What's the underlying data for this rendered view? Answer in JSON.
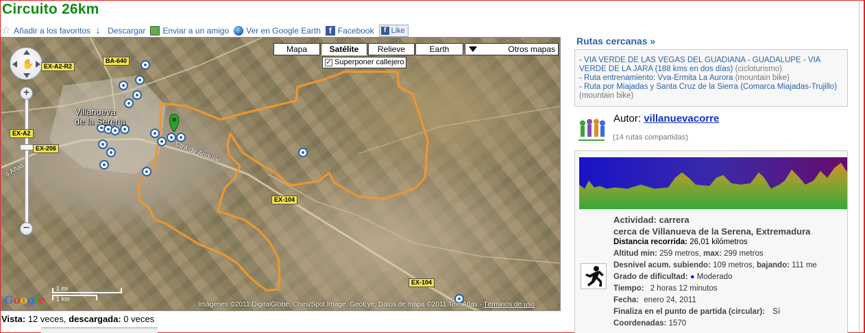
{
  "page": {
    "title": "Circuito 26km"
  },
  "actions": [
    {
      "label": "Añadir a los favoritos",
      "icon": "star-icon"
    },
    {
      "label": "Descargar",
      "icon": "download-arrow-icon"
    },
    {
      "label": "Enviar a un amigo",
      "icon": "email-icon"
    },
    {
      "label": "Ver en Google Earth",
      "icon": "google-earth-icon"
    },
    {
      "label": "Facebook",
      "icon": "facebook-icon"
    }
  ],
  "like_button": {
    "label": "Like"
  },
  "map": {
    "types": [
      "Mapa",
      "Satélite",
      "Relieve",
      "Earth"
    ],
    "active_type": "Satélite",
    "more_types": "Otros mapas",
    "overlay_checkbox": {
      "label": "Superponer callejero",
      "checked": true
    },
    "town_label": "Villanueva\nde la Serena",
    "town_line1": "Villanueva",
    "town_line2": "de la Serena",
    "road_label": "Ctra de Andújar",
    "side_road_label": "s Altas",
    "road_shields": [
      "EX-A2-R2",
      "BA-640",
      "EX-A2",
      "EX-206",
      "EX-104",
      "EX-104"
    ],
    "google_logo": "Google",
    "scale": {
      "top": "1 mi",
      "bottom": "1 km"
    },
    "attribution": "Imágenes ©2011 DigitalGlobe, Cnes/Spot Image, GeoEye, Datos de mapa ©2011 Tele Atlas - ",
    "terms": "Términos de uso",
    "route_color": "#f0962e",
    "marker_color": "#2aa32a"
  },
  "stats": {
    "vista_label": "Vista:",
    "vista_value": "12 veces,",
    "descargada_label": "descargada:",
    "descargada_value": "0 veces"
  },
  "nearby": {
    "title": "Rutas cercanas »",
    "routes": [
      {
        "name": "VIA VERDE DE LAS VEGAS DEL GUADIANA - GUADALUPE - VIA VERDE DE LA JARA (188 kms en dos días)",
        "type": "(cicloturismo)"
      },
      {
        "name": "Ruta entrenamiento: Vva-Ermita La Aurora",
        "type": "(mountain bike)"
      },
      {
        "name": "Ruta por Miajadas y Santa Cruz de la Sierra (Comarca Miajadas-Trujillo)",
        "type": "(mountain bike)"
      }
    ]
  },
  "author": {
    "label": "Autor:",
    "name": "villanuevacorre",
    "routes_shared": "(14 rutas compartidas)"
  },
  "details": {
    "actividad_label": "Actividad:",
    "actividad": "carrera",
    "cerca_label": "cerca de",
    "cerca": "Villanueva de la Serena, Extremadura",
    "distancia_label": "Distancia recorrida:",
    "distancia": "26,01 kilómetros",
    "altitud_min_label": "Altitud min:",
    "altitud_min": "259 metros,",
    "altitud_max_label": "max:",
    "altitud_max": "299 metros",
    "desnivel_label": "Desnivel acum. subiendo:",
    "desnivel_subiendo": "109 metros,",
    "bajando_label": "bajando:",
    "desnivel_bajando": "111 me",
    "dificultad_label": "Grado de dificultad:",
    "dificultad": "Moderado",
    "dificultad_color": "#1a1acc",
    "tiempo_label": "Tiempo:",
    "tiempo": "2 horas 12 minutos",
    "fecha_label": "Fecha:",
    "fecha": "enero 24, 2011",
    "finaliza_label": "Finaliza en el punto de partida (circular):",
    "finaliza": "Sí",
    "coordenadas_label": "Coordenadas:",
    "coordenadas": "1570"
  }
}
